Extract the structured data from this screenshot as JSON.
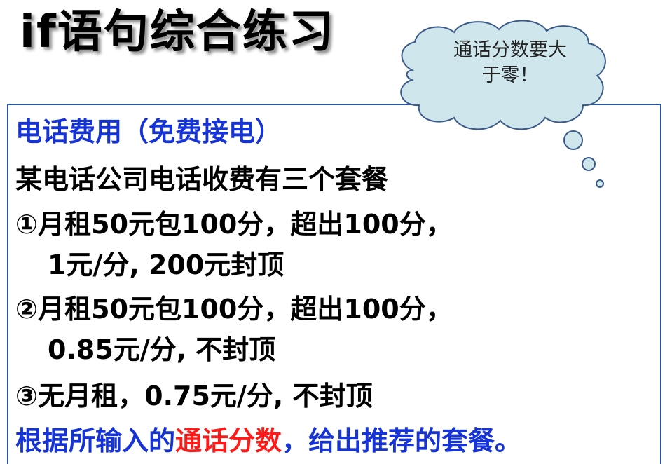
{
  "title": "if语句综合练习",
  "callout": {
    "line1": "通话分数要大",
    "line2": "于零！"
  },
  "content": {
    "heading": "电话费用（免费接电）",
    "intro": "某电话公司电话收费有三个套餐",
    "plan1_line1": "①月租50元包100分，超出100分，",
    "plan1_line2": "1元/分, 200元封顶",
    "plan2_line1": "②月租50元包100分，超出100分，",
    "plan2_line2": "0.85元/分, 不封顶",
    "plan3": "③无月租，0.75元/分, 不封顶",
    "task_part1": "根据所输入的",
    "task_part2": "通话分数",
    "task_part3": "，给出推荐的套餐。"
  },
  "colors": {
    "heading": "#1533d6",
    "highlight": "#ff1a1a",
    "cloud_fill": "#cfe6ec",
    "cloud_stroke": "#3a5a8a",
    "box_border": "#2b55a8"
  }
}
